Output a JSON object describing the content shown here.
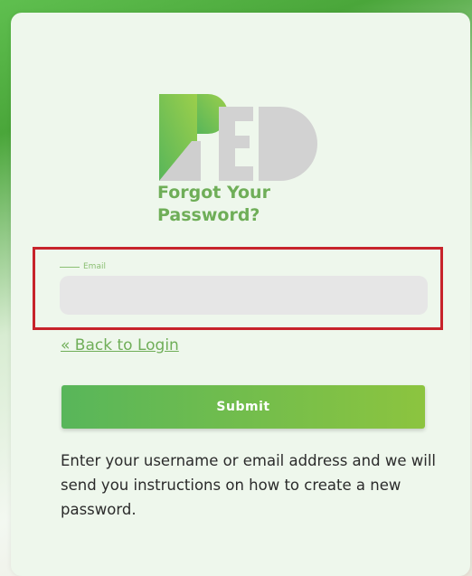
{
  "logo": {
    "text": "RED",
    "icon": "red-logo"
  },
  "page": {
    "title_line1": "Forgot Your",
    "title_line2": "Password?"
  },
  "form": {
    "email_label": "Email",
    "email_value": "",
    "back_link": "« Back to Login",
    "submit_label": "Submit"
  },
  "help_text": "Enter your username or email address and we will send you instructions on how to create a new password.",
  "colors": {
    "brand_green": "#6fae58",
    "submit_gradient_start": "#58b65a",
    "submit_gradient_end": "#8cc43f",
    "highlight_red": "#c7232b",
    "logo_gray": "#d2d2d2"
  }
}
